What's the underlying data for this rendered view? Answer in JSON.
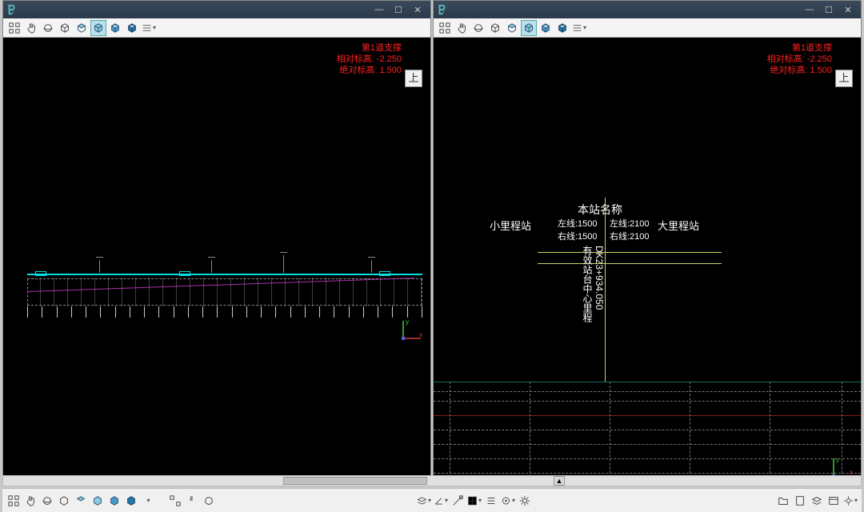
{
  "left": {
    "title": "",
    "red_info": {
      "line1": "第1道支撑",
      "line2": "相对标高: -2.250",
      "line3": "绝对标高: 1.500"
    },
    "view_label": "上",
    "coord": {
      "x": "x",
      "y": "y"
    }
  },
  "right": {
    "title": "",
    "red_info": {
      "line1": "第1道支撑",
      "line2": "相对标高: -2.250",
      "line3": "绝对标高: 1.500"
    },
    "view_label": "上",
    "station": {
      "name_label": "本站名称",
      "small_station": "小里程站",
      "big_station": "大里程站",
      "left_top": "左线:1500",
      "left_bot": "右线:1500",
      "right_top": "左线:2100",
      "right_bot": "右线:2100",
      "center_label_v": "有效站台中心里程",
      "mileage_v": "DK23+934.050"
    },
    "coord": {
      "x": "x",
      "y": "y"
    }
  },
  "win_buttons": {
    "min": "—",
    "max": "☐",
    "close": "✕"
  },
  "scroll_up_arrow": "▲",
  "colors": {
    "cyan": "#00e0e0",
    "red_text": "#ff2020",
    "magenta": "#aa30aa",
    "olive": "#cfcf60"
  }
}
